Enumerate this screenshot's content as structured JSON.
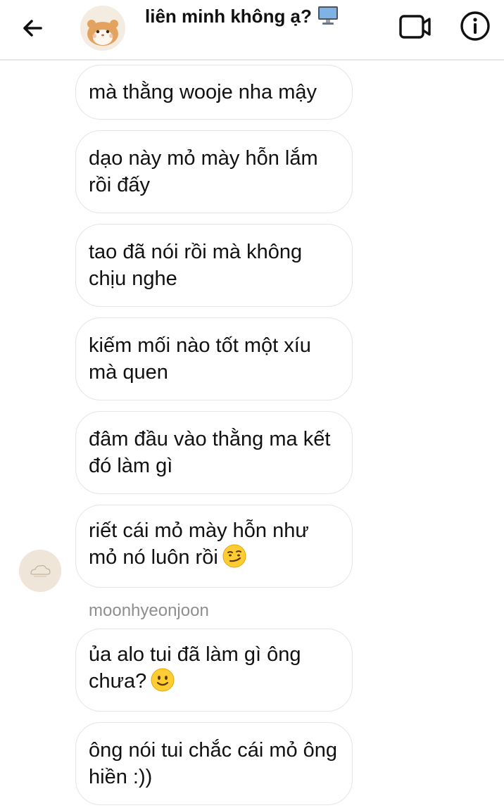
{
  "header": {
    "title": "liên minh không ạ?",
    "title_emoji": "desktop-computer-icon",
    "back_icon": "arrow-left-icon",
    "video_icon": "video-camera-icon",
    "info_icon": "info-icon"
  },
  "thread": {
    "sender_name": "moonhyeonjoon",
    "messages": [
      {
        "text": "mà thằng wooje nha mậy"
      },
      {
        "text": "dạo này mỏ mày hỗn lắm rồi đấy"
      },
      {
        "text": "tao đã nói rồi mà không chịu nghe"
      },
      {
        "text": "kiếm mối nào tốt một xíu mà quen"
      },
      {
        "text": "đâm đầu vào thằng ma kết đó làm gì"
      },
      {
        "text": "riết cái mỏ mày hỗn như mỏ nó luôn rồi",
        "emoji": "smirk-emoji"
      },
      {
        "text": "ủa alo tui đã làm gì ông chưa?",
        "emoji": "slight-smile-emoji"
      },
      {
        "text": "ông nói tui chắc cái mỏ ông hiền :))"
      }
    ]
  },
  "colors": {
    "bubble_border": "#e5e5e5",
    "meta_text": "#8e8e8e",
    "header_divider": "#e6e6e6"
  }
}
